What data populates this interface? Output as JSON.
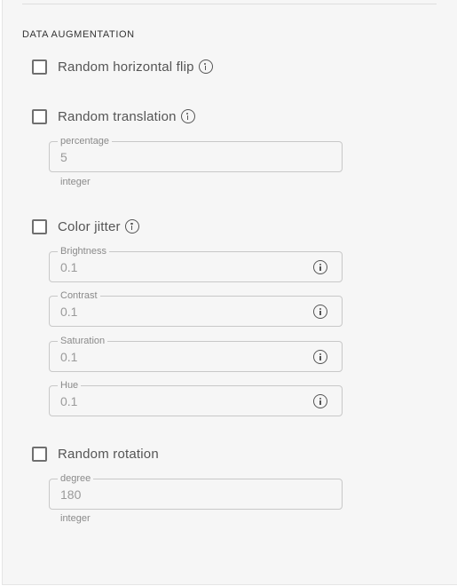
{
  "section": {
    "title": "DATA AUGMENTATION"
  },
  "options": {
    "flip": {
      "label": "Random horizontal flip",
      "checked": false
    },
    "translation": {
      "label": "Random translation",
      "checked": false,
      "field_label": "percentage",
      "value": "5",
      "hint": "integer"
    },
    "jitter": {
      "label": "Color jitter",
      "checked": false,
      "fields": [
        {
          "label": "Brightness",
          "value": "0.1"
        },
        {
          "label": "Contrast",
          "value": "0.1"
        },
        {
          "label": "Saturation",
          "value": "0.1"
        },
        {
          "label": "Hue",
          "value": "0.1"
        }
      ]
    },
    "rotation": {
      "label": "Random rotation",
      "checked": false,
      "field_label": "degree",
      "value": "180",
      "hint": "integer"
    }
  },
  "icons": {
    "info": "info-icon",
    "checkbox": "checkbox-unchecked"
  }
}
